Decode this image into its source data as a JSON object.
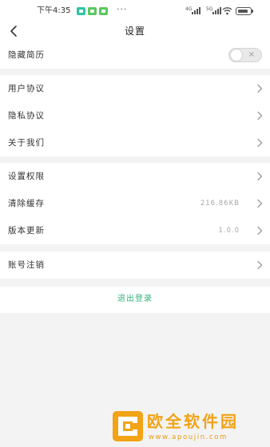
{
  "status_bar": {
    "time": "下午4:35",
    "notification_icon_colors": [
      "#2fc4a4",
      "#5ac85e",
      "#5ac85e"
    ],
    "more_indicator": "···",
    "signal_labels": [
      "4G",
      "5G"
    ]
  },
  "header": {
    "title": "设置",
    "back_icon": "chevron-left-icon"
  },
  "groups": [
    {
      "rows": [
        {
          "label": "隐藏简历",
          "control": "toggle",
          "toggle_on": false,
          "toggle_off_symbol": "×"
        }
      ]
    },
    {
      "rows": [
        {
          "label": "用户协议",
          "control": "chevron"
        },
        {
          "label": "隐私协议",
          "control": "chevron"
        },
        {
          "label": "关于我们",
          "control": "chevron"
        }
      ]
    },
    {
      "rows": [
        {
          "label": "设置权限",
          "control": "chevron"
        },
        {
          "label": "清除缓存",
          "value": "216.86KB",
          "control": "chevron"
        },
        {
          "label": "版本更新",
          "value": "1.0.0",
          "control": "chevron"
        }
      ]
    },
    {
      "rows": [
        {
          "label": "账号注销",
          "control": "chevron"
        }
      ]
    }
  ],
  "logout": {
    "label": "退出登录",
    "color": "#36b37e"
  },
  "watermark": {
    "title": "欧全软件园",
    "url": "www.apoujin.com",
    "color": "#f2a316"
  }
}
